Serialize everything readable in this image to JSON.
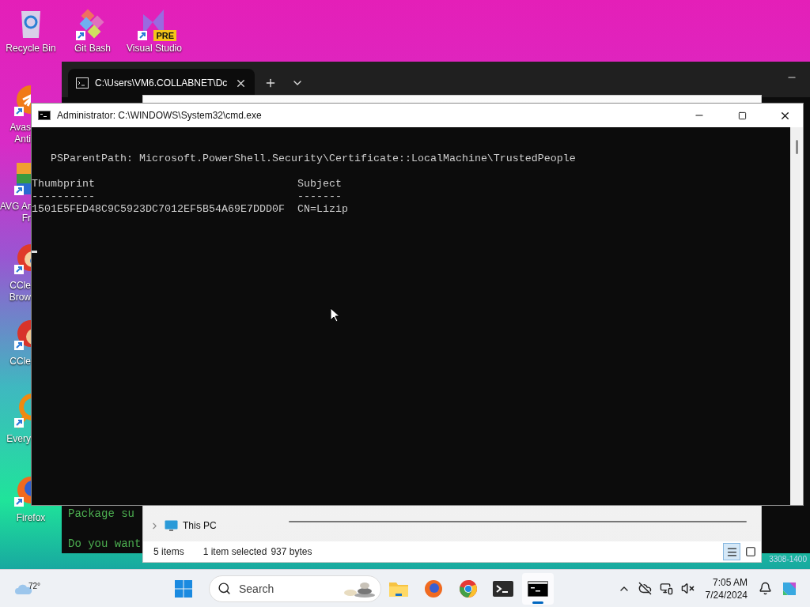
{
  "desktop": {
    "icons": [
      {
        "kind": "recycle-bin",
        "label": "Recycle Bin",
        "shortcut": false
      },
      {
        "kind": "git-bash",
        "label": "Git Bash",
        "shortcut": true
      },
      {
        "kind": "visual-studio",
        "label": "Visual Studio",
        "shortcut": true,
        "badge": "PRE"
      }
    ],
    "side_icons": [
      {
        "kind": "avast",
        "lines": [
          "Avas",
          "Anti"
        ],
        "covered": true
      },
      {
        "kind": "avg",
        "lines": [
          "AVG Ar",
          "Fr"
        ],
        "covered": true
      },
      {
        "kind": "ccleaner-browser",
        "lines": [
          "CCle",
          "Brow"
        ],
        "covered": true
      },
      {
        "kind": "ccleaner",
        "lines": [
          "CCle"
        ],
        "covered": true
      },
      {
        "kind": "everything",
        "lines": [
          "Every"
        ],
        "covered": true
      },
      {
        "kind": "firefox",
        "lines": [
          "Firefox"
        ],
        "covered": false
      }
    ],
    "build_text": "3308-1400"
  },
  "terminal_window": {
    "tab": {
      "title": "C:\\Users\\VM6.COLLABNET\\Dc",
      "selected": true
    },
    "lines": [
      "Package su",
      "Do you want"
    ]
  },
  "explorer_window": {
    "nav_item": "This PC",
    "status": {
      "items": "5 items",
      "selection": "1 item selected",
      "size": "937 bytes"
    },
    "views": [
      {
        "kind": "details",
        "selected": true
      },
      {
        "kind": "tiles",
        "selected": false
      }
    ]
  },
  "cmd_window": {
    "title": "Administrator: C:\\WINDOWS\\System32\\cmd.exe",
    "lines": [
      {
        "kind": "path",
        "text": "PSParentPath: Microsoft.PowerShell.Security\\Certificate::LocalMachine\\TrustedPeople"
      },
      {
        "kind": "header",
        "text": "Thumbprint                                Subject"
      },
      {
        "kind": "rule",
        "text": "----------                                -------"
      },
      {
        "kind": "row",
        "text": "1501E5FED48C9C5923DC7012EF5B54A69E7DDD0F  CN=Lizip"
      }
    ]
  },
  "taskbar": {
    "weather": "72°",
    "search": {
      "placeholder": "Search"
    },
    "apps": [
      {
        "kind": "folder",
        "selected": false
      },
      {
        "kind": "firefox",
        "selected": false
      },
      {
        "kind": "chrome",
        "selected": false
      },
      {
        "kind": "terminal",
        "selected": false
      },
      {
        "kind": "console",
        "selected": true
      }
    ],
    "clock": {
      "time": "7:05 AM",
      "date": "7/24/2024"
    }
  }
}
